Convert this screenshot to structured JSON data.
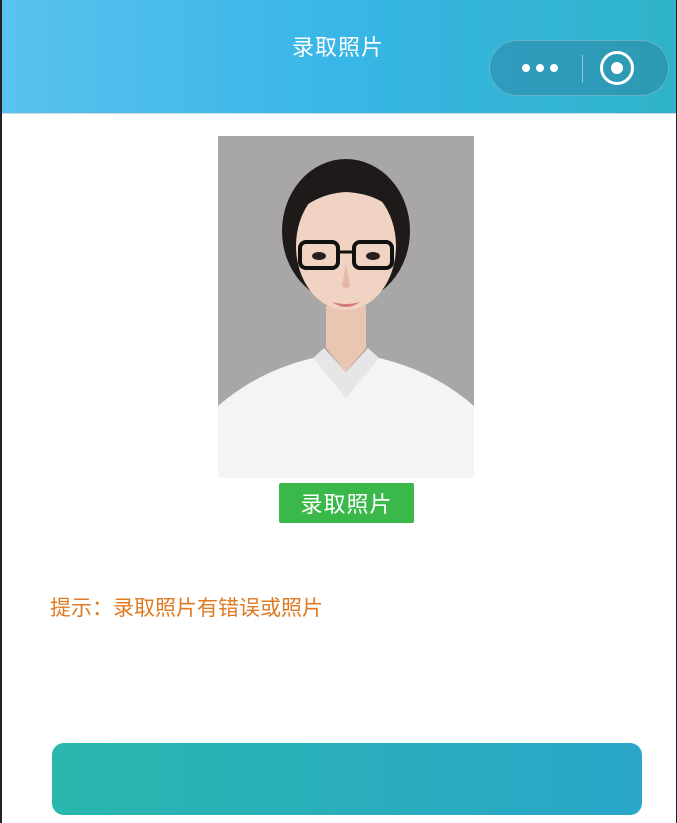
{
  "header": {
    "title": "录取照片",
    "more_icon": "more-dots-icon",
    "close_icon": "close-circle-icon"
  },
  "photo": {
    "alt": "录取照片"
  },
  "tag": {
    "label": "录取照片"
  },
  "hint": {
    "text": "提示：录取照片有错误或照片"
  },
  "action": {
    "label": ""
  },
  "colors": {
    "header_start": "#5ac2ee",
    "header_end": "#2fb3c8",
    "tag_green": "#3bb84a",
    "hint_orange": "#e07a22",
    "action_teal": "#2ab7ae"
  }
}
